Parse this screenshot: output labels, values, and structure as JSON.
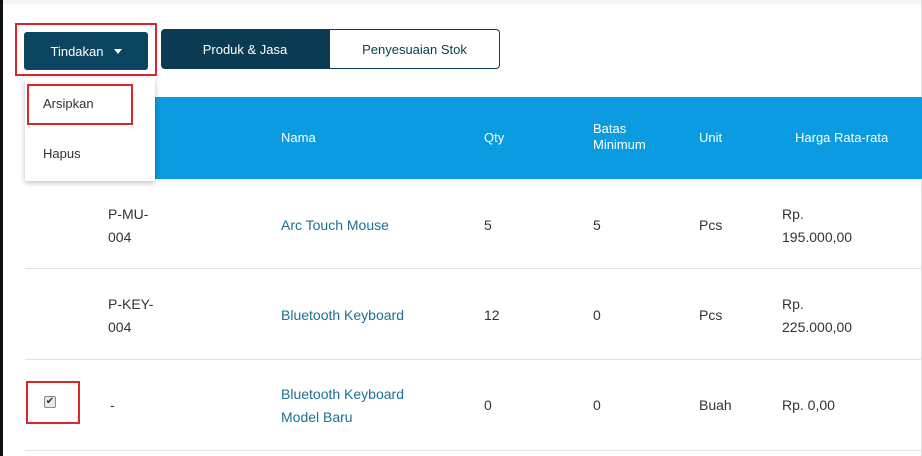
{
  "toolbar": {
    "actions_label": "Tindakan",
    "tab_products": "Produk & Jasa",
    "tab_stock_adjust": "Penyesuaian Stok"
  },
  "dropdown": {
    "archive": "Arsipkan",
    "delete": "Hapus"
  },
  "table": {
    "columns": [
      "Nama",
      "Qty",
      "Batas Minimum",
      "Unit",
      "Harga Rata-rata"
    ],
    "column_batas_1": "Batas",
    "column_batas_2": "Minimum",
    "rows": [
      {
        "code_1": "P-MU-",
        "code_2": "004",
        "name_1": "Arc Touch Mouse",
        "name_2": "",
        "qty": "5",
        "min": "5",
        "unit": "Pcs",
        "price_1": "Rp.",
        "price_2": "195.000,00",
        "checked": false
      },
      {
        "code_1": "P-KEY-",
        "code_2": "004",
        "name_1": "Bluetooth Keyboard",
        "name_2": "",
        "qty": "12",
        "min": "0",
        "unit": "Pcs",
        "price_1": "Rp.",
        "price_2": "225.000,00",
        "checked": false
      },
      {
        "code_1": "-",
        "code_2": "",
        "name_1": "Bluetooth Keyboard",
        "name_2": "Model Baru",
        "qty": "0",
        "min": "0",
        "unit": "Buah",
        "price_1": "Rp. 0,00",
        "price_2": "",
        "checked": true
      }
    ]
  },
  "colors": {
    "header_blue": "#0a9be0",
    "dark_navy": "#0b3b52",
    "highlight_red": "#d9262c",
    "link": "#1b6f96"
  }
}
